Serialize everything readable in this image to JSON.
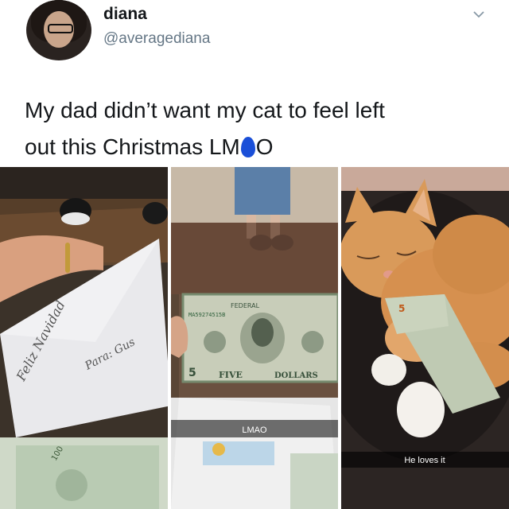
{
  "user": {
    "name": "diana",
    "handle": "@averagediana"
  },
  "tweet": {
    "line1": "My dad didn’t want my cat to feel left",
    "line2_before": "out this Christmas LM",
    "line2_after": "O"
  },
  "photos": {
    "photo1": {
      "envelope_left": "Feliz Navidad",
      "envelope_right": "Para: Gus"
    },
    "photo2": {
      "caption": "LMAO",
      "bill_top": "FEDERAL",
      "bill_bottom_left": "FIVE",
      "bill_bottom_right": "DOLLARS"
    },
    "photo3": {
      "caption": "He loves it"
    }
  },
  "colors": {
    "text_primary": "#14171a",
    "text_secondary": "#657786",
    "emoji_blue": "#1a4fd8"
  }
}
